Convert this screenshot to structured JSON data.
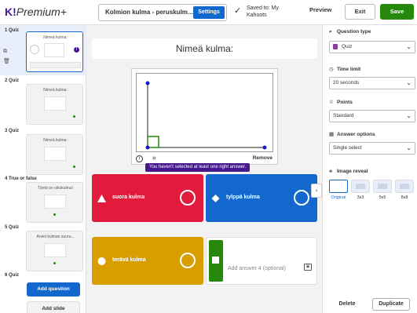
{
  "header": {
    "logo_k": "K!",
    "logo_plus": "Premium+",
    "title": "Kolmion kulma - peruskulm...",
    "settings_label": "Settings",
    "saved_text": "Saved to: My Kahoots",
    "preview_label": "Preview",
    "exit_label": "Exit",
    "save_label": "Save"
  },
  "sidebar": {
    "slides": [
      {
        "label": "1 Quiz",
        "title": "Nimeä kulma:"
      },
      {
        "label": "2 Quiz",
        "title": "Nimeä kulma:"
      },
      {
        "label": "3 Quiz",
        "title": "Nimeä kulma:"
      },
      {
        "label": "4 True or false",
        "title": "Tämä on oikokulma!"
      },
      {
        "label": "5 Quiz",
        "title": "Arvioi kulman suuru..."
      },
      {
        "label": "6 Quiz",
        "title": ""
      }
    ],
    "active_warning": "!",
    "add_question_label": "Add question",
    "add_slide_label": "Add slide"
  },
  "main": {
    "question": "Nimeä kulma:",
    "remove_label": "Remove",
    "tooltip": "You haven't selected at least one right answer.",
    "answers": [
      {
        "label": "suora kulma",
        "color": "#e21b3c",
        "shape": "triangle"
      },
      {
        "label": "tylppä kulma",
        "color": "#1368ce",
        "shape": "diamond"
      },
      {
        "label": "terävä kulma",
        "color": "#d89e00",
        "shape": "circle"
      },
      {
        "placeholder": "Add answer 4 (optional)",
        "color": "#26890c",
        "shape": "square"
      }
    ]
  },
  "panel": {
    "question_type_label": "Question type",
    "question_type_value": "Quiz",
    "time_limit_label": "Time limit",
    "time_limit_value": "20 seconds",
    "points_label": "Points",
    "points_value": "Standard",
    "answer_options_label": "Answer options",
    "answer_options_value": "Single select",
    "image_reveal_label": "Image reveal",
    "reveal_options": [
      "Original",
      "3x3",
      "5x5",
      "8x8"
    ],
    "delete_label": "Delete",
    "duplicate_label": "Duplicate"
  }
}
